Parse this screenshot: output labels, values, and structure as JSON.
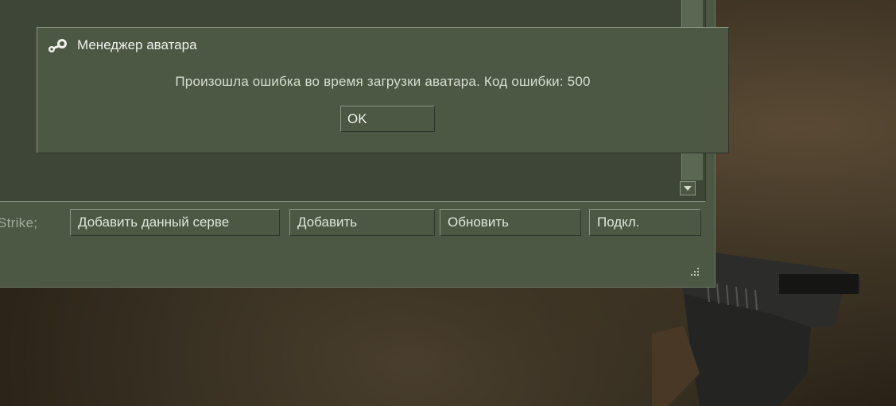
{
  "server_browser": {
    "filter_text": "-Strike;",
    "buttons": {
      "add_current_server": "Добавить данный серве",
      "add": "Добавить",
      "refresh": "Обновить",
      "connect": "Подкл."
    }
  },
  "dialog": {
    "title": "Менеджер аватара",
    "message": "Произошла ошибка во время загрузки аватара. Код ошибки: 500",
    "ok_label": "OK",
    "icon": "steam-icon"
  },
  "colors": {
    "panel": "#4c5844",
    "panel_dark": "#3e4637",
    "text": "#e0e6dc"
  }
}
